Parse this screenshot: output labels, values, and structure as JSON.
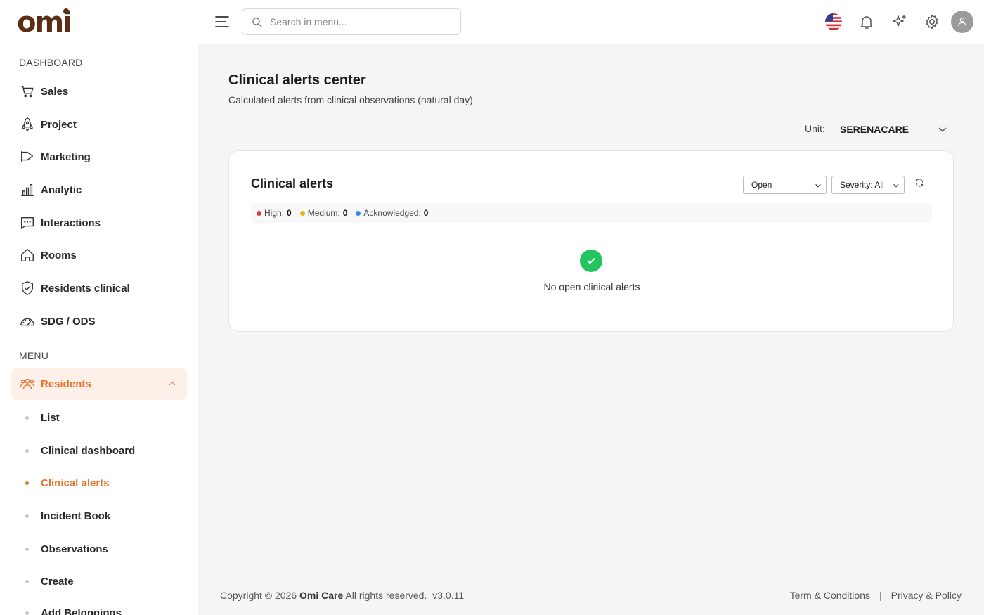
{
  "brand": {
    "logo_text": "omi"
  },
  "sidebar": {
    "dashboard_title": "DASHBOARD",
    "dashboard_items": [
      {
        "label": "Sales",
        "icon": "cart-icon"
      },
      {
        "label": "Project",
        "icon": "rocket-icon"
      },
      {
        "label": "Marketing",
        "icon": "megaphone-icon"
      },
      {
        "label": "Analytic",
        "icon": "bar-chart-icon"
      },
      {
        "label": "Interactions",
        "icon": "chat-icon"
      },
      {
        "label": "Rooms",
        "icon": "home-icon"
      },
      {
        "label": "Residents clinical",
        "icon": "shield-check-icon"
      },
      {
        "label": "SDG / ODS",
        "icon": "gauge-icon"
      }
    ],
    "menu_title": "MENU",
    "residents": {
      "label": "Residents",
      "icon": "users-icon",
      "expanded": true,
      "sub_items": [
        {
          "label": "List",
          "active": false
        },
        {
          "label": "Clinical dashboard",
          "active": false
        },
        {
          "label": "Clinical alerts",
          "active": true
        },
        {
          "label": "Incident Book",
          "active": false
        },
        {
          "label": "Observations",
          "active": false
        },
        {
          "label": "Create",
          "active": false
        },
        {
          "label": "Add Belongings",
          "active": false
        }
      ]
    }
  },
  "topbar": {
    "search_placeholder": "Search in menu...",
    "icons": [
      "menu-icon",
      "us-flag-icon",
      "bell-icon",
      "sparkle-icon",
      "gear-icon",
      "avatar-icon"
    ]
  },
  "main": {
    "title": "Clinical alerts center",
    "subtitle": "Calculated alerts from clinical observations (natural day)",
    "unit_label": "Unit:",
    "unit_value": "SERENACARE",
    "card": {
      "title": "Clinical alerts",
      "status_filter": "Open",
      "severity_filter": "Severity: All",
      "stats": [
        {
          "label": "High:",
          "value": "0",
          "color": "#e53935"
        },
        {
          "label": "Medium:",
          "value": "0",
          "color": "#e8b41a"
        },
        {
          "label": "Acknowledged:",
          "value": "0",
          "color": "#3b82f6"
        }
      ],
      "empty_message": "No open clinical alerts"
    }
  },
  "footer": {
    "copyright_prefix": "Copyright © 2026",
    "company": "Omi Care",
    "rights": "All rights reserved.",
    "version": "v3.0.11",
    "terms": "Term & Conditions",
    "separator": "|",
    "privacy": "Privacy & Policy"
  },
  "colors": {
    "accent": "#e8732f",
    "brand": "#5a2d14",
    "success": "#22c55e"
  }
}
